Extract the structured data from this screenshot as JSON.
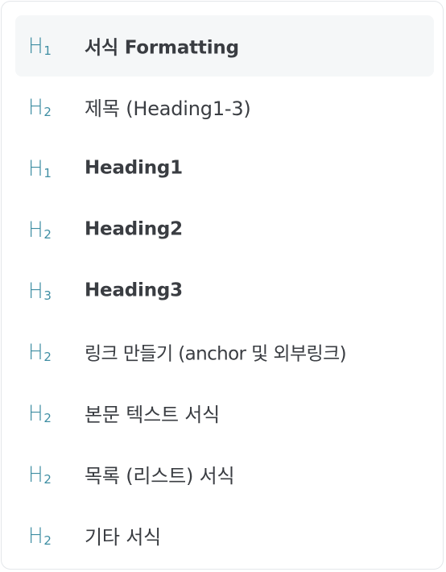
{
  "toc": {
    "items": [
      {
        "level": "1",
        "label": "서식 Formatting",
        "active": true,
        "bold": true
      },
      {
        "level": "2",
        "label": "제목 (Heading1-3)",
        "active": false,
        "bold": false
      },
      {
        "level": "1",
        "label": "Heading1",
        "active": false,
        "bold": true
      },
      {
        "level": "2",
        "label": "Heading2",
        "active": false,
        "bold": true
      },
      {
        "level": "3",
        "label": "Heading3",
        "active": false,
        "bold": true
      },
      {
        "level": "2",
        "label": "링크 만들기 (anchor 및 외부링크)",
        "active": false,
        "bold": false
      },
      {
        "level": "2",
        "label": "본문 텍스트 서식",
        "active": false,
        "bold": false
      },
      {
        "level": "2",
        "label": "목록 (리스트) 서식",
        "active": false,
        "bold": false
      },
      {
        "level": "2",
        "label": "기타 서식",
        "active": false,
        "bold": false
      }
    ],
    "icon_letter": "H"
  },
  "colors": {
    "icon": "#3f8ea3",
    "text": "#3a3d42",
    "active_bg": "#f5f7f8",
    "border": "#e4e7ea"
  }
}
